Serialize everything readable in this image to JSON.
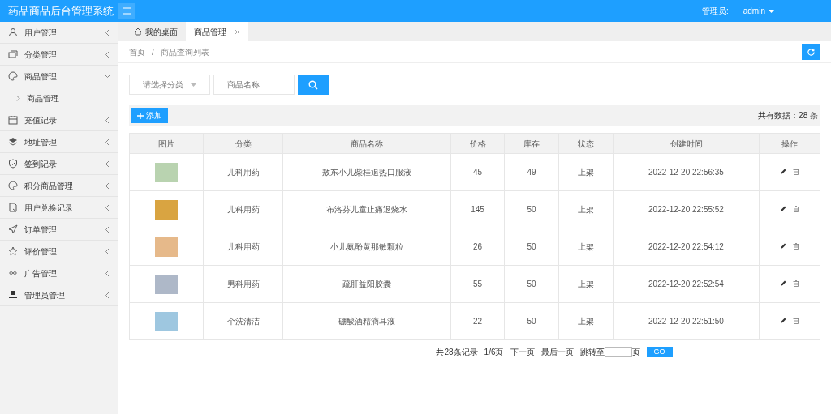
{
  "header": {
    "title": "药品商品后台管理系统",
    "user_label": "管理员:",
    "user_name": "admin"
  },
  "sidebar": {
    "items": [
      {
        "label": "用户管理",
        "expanded": false
      },
      {
        "label": "分类管理",
        "expanded": false
      },
      {
        "label": "商品管理",
        "expanded": true,
        "children": [
          {
            "label": "商品管理"
          }
        ]
      },
      {
        "label": "充值记录",
        "expanded": false
      },
      {
        "label": "地址管理",
        "expanded": false
      },
      {
        "label": "签到记录",
        "expanded": false
      },
      {
        "label": "积分商品管理",
        "expanded": false
      },
      {
        "label": "用户兑换记录",
        "expanded": false
      },
      {
        "label": "订单管理",
        "expanded": false
      },
      {
        "label": "评价管理",
        "expanded": false
      },
      {
        "label": "广告管理",
        "expanded": false
      },
      {
        "label": "管理员管理",
        "expanded": false
      }
    ]
  },
  "tabs": [
    {
      "label": "我的桌面",
      "selected": false,
      "closable": false
    },
    {
      "label": "商品管理",
      "selected": true,
      "closable": true
    }
  ],
  "breadcrumb": {
    "items": [
      "首页",
      "商品查询列表"
    ],
    "separator": "/"
  },
  "search": {
    "category_placeholder": "请选择分类",
    "name_placeholder": "商品名称"
  },
  "toolbar": {
    "add_label": "添加",
    "total": "共有数据：28 条"
  },
  "table": {
    "columns": [
      "图片",
      "分类",
      "商品名称",
      "价格",
      "库存",
      "状态",
      "创建时间",
      "操作"
    ],
    "rows": [
      {
        "category": "儿科用药",
        "name": "敖东小儿柴桂退热口服液",
        "price": "45",
        "stock": "49",
        "status": "上架",
        "created": "2022-12-20 22:56:35"
      },
      {
        "category": "儿科用药",
        "name": "布洛芬儿童止痛退烧水",
        "price": "145",
        "stock": "50",
        "status": "上架",
        "created": "2022-12-20 22:55:52"
      },
      {
        "category": "儿科用药",
        "name": "小儿氨酚黄那敏颗粒",
        "price": "26",
        "stock": "50",
        "status": "上架",
        "created": "2022-12-20 22:54:12"
      },
      {
        "category": "男科用药",
        "name": "疏肝益阳胶囊",
        "price": "55",
        "stock": "50",
        "status": "上架",
        "created": "2022-12-20 22:52:54"
      },
      {
        "category": "个洗清洁",
        "name": "硼酸酒精滴耳液",
        "price": "22",
        "stock": "50",
        "status": "上架",
        "created": "2022-12-20 22:51:50"
      }
    ]
  },
  "pagination": {
    "total": "共28条记录",
    "page": "1/6页",
    "next": "下一页",
    "last": "最后一页",
    "jump_label": "跳转至",
    "page_unit": "页",
    "go": "GO"
  }
}
